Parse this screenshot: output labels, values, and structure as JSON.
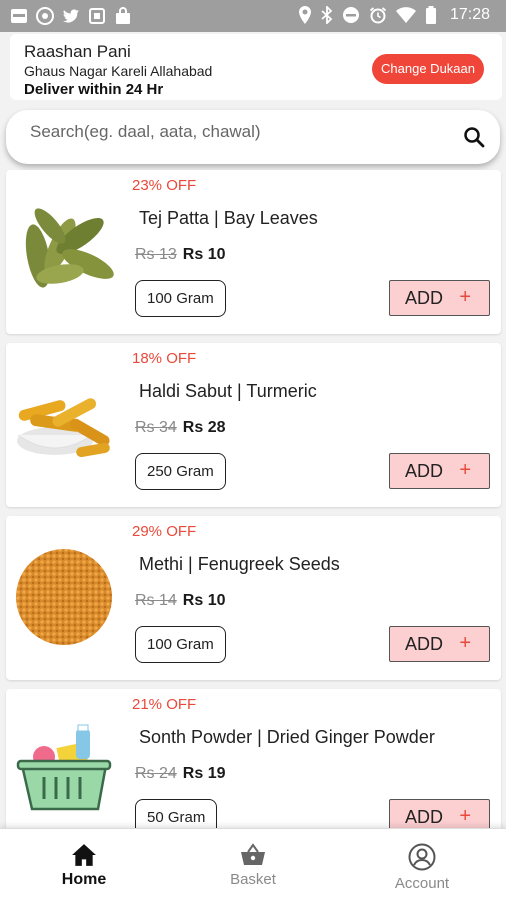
{
  "status_bar": {
    "time": "17:28",
    "icons": [
      "notification-icon",
      "chrome-icon",
      "twitter-icon",
      "app-icon",
      "shopping-bag-icon",
      "location-icon",
      "bluetooth-icon",
      "do-not-disturb-icon",
      "alarm-icon",
      "wifi-icon",
      "battery-icon"
    ]
  },
  "header": {
    "store_name": "Raashan Pani",
    "address": "Ghaus Nagar Kareli Allahabad",
    "delivery": "Deliver within 24 Hr",
    "change_button": "Change Dukaan"
  },
  "search": {
    "placeholder": "Search(eg. daal, aata, chawal)"
  },
  "products": [
    {
      "discount": "23% OFF",
      "name": "Tej Patta  |  Bay Leaves",
      "old_price": "Rs 13",
      "price": "Rs 10",
      "quantity": "100 Gram",
      "add_label": "ADD",
      "image": "bay-leaves-image"
    },
    {
      "discount": "18% OFF",
      "name": "Haldi Sabut  |  Turmeric",
      "old_price": "Rs 34",
      "price": "Rs 28",
      "quantity": "250 Gram",
      "add_label": "ADD",
      "image": "turmeric-image"
    },
    {
      "discount": "29% OFF",
      "name": "Methi  |  Fenugreek Seeds",
      "old_price": "Rs 14",
      "price": "Rs 10",
      "quantity": "100 Gram",
      "add_label": "ADD",
      "image": "fenugreek-image"
    },
    {
      "discount": "21% OFF",
      "name": "Sonth Powder  |  Dried Ginger Powder",
      "old_price": "Rs 24",
      "price": "Rs 19",
      "quantity": "50 Gram",
      "add_label": "ADD",
      "image": "basket-placeholder-image"
    }
  ],
  "bottom_nav": {
    "items": [
      {
        "label": "Home",
        "icon": "home-icon",
        "active": true
      },
      {
        "label": "Basket",
        "icon": "basket-icon",
        "active": false
      },
      {
        "label": "Account",
        "icon": "account-icon",
        "active": false
      }
    ]
  },
  "colors": {
    "accent": "#f0463a",
    "discount": "#e8493a",
    "add_button_bg": "#fccfd1",
    "status_bar": "#9e9e9e"
  }
}
